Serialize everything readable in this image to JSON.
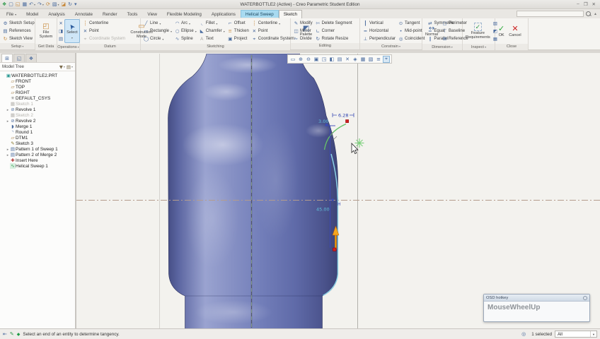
{
  "titlebar": {
    "title": "WATERBOTTLE2 (Active) - Creo Parametric Student Edition",
    "quick_access": [
      {
        "glyph": "❖",
        "icon": "creo-app-icon",
        "cls": "gr"
      },
      {
        "glyph": "▢",
        "icon": "new-file-icon"
      },
      {
        "glyph": "◱",
        "icon": "open-file-icon",
        "cls": "or"
      },
      {
        "glyph": "▦",
        "icon": "save-icon"
      },
      {
        "glyph": "↶",
        "icon": "undo-icon",
        "arrow": true
      },
      {
        "glyph": "↷",
        "icon": "redo-icon",
        "arrow": true
      },
      {
        "glyph": "⟳",
        "icon": "regenerate-icon",
        "cls": "or"
      },
      {
        "glyph": "▧",
        "icon": "window-gallery-icon",
        "arrow": true
      },
      {
        "glyph": "◪",
        "icon": "close-window-icon",
        "cls": "or"
      },
      {
        "glyph": "↻",
        "icon": "refresh-icon"
      },
      {
        "glyph": "▾",
        "icon": "customize-quick-access-icon"
      }
    ],
    "window_controls": [
      {
        "glyph": "–",
        "icon": "minimize-icon"
      },
      {
        "glyph": "❐",
        "icon": "restore-icon"
      },
      {
        "glyph": "✕",
        "icon": "close-icon"
      }
    ]
  },
  "tabs": [
    {
      "label": "File",
      "arrow": true
    },
    {
      "label": "Model"
    },
    {
      "label": "Analysis"
    },
    {
      "label": "Annotate"
    },
    {
      "label": "Render"
    },
    {
      "label": "Tools"
    },
    {
      "label": "View"
    },
    {
      "label": "Flexible Modeling"
    },
    {
      "label": "Applications"
    },
    {
      "label": "Helical Sweep",
      "cls": "context"
    },
    {
      "label": "Sketch",
      "cls": "active"
    }
  ],
  "ribbon": {
    "setup": {
      "label": "Setup",
      "items": [
        {
          "label": "Sketch Setup",
          "glyph": "⚙",
          "icon": "sketch-setup-icon"
        },
        {
          "label": "References",
          "glyph": "▤",
          "icon": "references-icon"
        },
        {
          "label": "Sketch View",
          "glyph": "↻",
          "icon": "sketch-view-icon",
          "cls": "or"
        }
      ]
    },
    "get_data": {
      "label": "Get Data",
      "big": {
        "label": "File System",
        "glyph": "◰",
        "icon": "file-system-icon"
      }
    },
    "operations": {
      "label": "Operations",
      "clipboard": [
        {
          "glyph": "✕",
          "icon": "cut-icon"
        },
        {
          "glyph": "◨",
          "icon": "copy-icon"
        },
        {
          "glyph": "▤",
          "icon": "paste-icon"
        }
      ],
      "select": {
        "label": "Select",
        "arrow": true
      }
    },
    "datum": {
      "label": "Datum",
      "items": [
        {
          "label": "Centerline",
          "glyph": "┆",
          "icon": "centerline-datum-icon",
          "cls": "or"
        },
        {
          "label": "Point",
          "glyph": "✕",
          "icon": "point-datum-icon"
        },
        {
          "label": "Coordinate System",
          "glyph": "⌖",
          "icon": "coordinate-system-datum-icon",
          "cls": "dis",
          "disabled": true
        }
      ],
      "big": {
        "label": "Construction Mode",
        "glyph": "▭",
        "icon": "construction-mode-icon"
      }
    },
    "sketching": {
      "label": "Sketching",
      "items": [
        {
          "label": "Line",
          "glyph": "╱",
          "icon": "line-tool-icon",
          "arrow": true
        },
        {
          "label": "Rectangle",
          "glyph": "▭",
          "icon": "rectangle-tool-icon",
          "arrow": true
        },
        {
          "label": "Circle",
          "glyph": "◯",
          "icon": "circle-tool-icon",
          "arrow": true
        },
        {
          "label": "Arc",
          "glyph": "◠",
          "icon": "arc-tool-icon",
          "arrow": true
        },
        {
          "label": "Ellipse",
          "glyph": "○",
          "icon": "ellipse-tool-icon",
          "arrow": true
        },
        {
          "label": "Spline",
          "glyph": "∿",
          "icon": "spline-tool-icon"
        },
        {
          "label": "Fillet",
          "glyph": "◟",
          "icon": "fillet-tool-icon",
          "arrow": true
        },
        {
          "label": "Chamfer",
          "glyph": "◣",
          "icon": "chamfer-tool-icon",
          "arrow": true
        },
        {
          "label": "Text",
          "glyph": "A",
          "icon": "text-tool-icon",
          "cls": "dis",
          "disabled": true
        },
        {
          "label": "Offset",
          "glyph": "⌐",
          "icon": "offset-tool-icon"
        },
        {
          "label": "Thicken",
          "glyph": "≡",
          "icon": "thicken-tool-icon",
          "cls": "or"
        },
        {
          "label": "Project",
          "glyph": "▣",
          "icon": "project-tool-icon"
        },
        {
          "label": "Centerline",
          "glyph": "┆",
          "icon": "centerline-tool-icon",
          "arrow": true,
          "cls": "or"
        },
        {
          "label": "Point",
          "glyph": "✕",
          "icon": "point-tool-icon"
        },
        {
          "label": "Coordinate System",
          "glyph": "⌖",
          "icon": "coordinate-system-tool-icon"
        }
      ],
      "palette": {
        "label": "Palette",
        "glyph": "◩",
        "icon": "palette-icon"
      }
    },
    "editing": {
      "label": "Editing",
      "items": [
        {
          "label": "Modify",
          "glyph": "✎",
          "icon": "modify-icon"
        },
        {
          "label": "Mirror",
          "glyph": "◫",
          "icon": "mirror-icon"
        },
        {
          "label": "Divide",
          "glyph": "✁",
          "icon": "divide-icon"
        },
        {
          "label": "Delete Segment",
          "glyph": "✄",
          "icon": "delete-segment-icon"
        },
        {
          "label": "Corner",
          "glyph": "∟",
          "icon": "corner-icon"
        },
        {
          "label": "Rotate Resize",
          "glyph": "↻",
          "icon": "rotate-resize-icon"
        }
      ]
    },
    "constrain": {
      "label": "Constrain",
      "items": [
        {
          "label": "Vertical",
          "glyph": "┃",
          "icon": "vertical-constraint-icon"
        },
        {
          "label": "Horizontal",
          "glyph": "━",
          "icon": "horizontal-constraint-icon"
        },
        {
          "label": "Perpendicular",
          "glyph": "⊥",
          "icon": "perpendicular-constraint-icon"
        },
        {
          "label": "Tangent",
          "glyph": "⊙",
          "icon": "tangent-constraint-icon"
        },
        {
          "label": "Mid-point",
          "glyph": "•",
          "icon": "midpoint-constraint-icon"
        },
        {
          "label": "Coincident",
          "glyph": "◎",
          "icon": "coincident-constraint-icon"
        },
        {
          "label": "Symmetric",
          "glyph": "⇄",
          "icon": "symmetric-constraint-icon"
        },
        {
          "label": "Equal",
          "glyph": "=",
          "icon": "equal-constraint-icon"
        },
        {
          "label": "Parallel",
          "glyph": "∥",
          "icon": "parallel-constraint-icon"
        }
      ]
    },
    "dimension": {
      "label": "Dimension",
      "big": {
        "label": "Normal",
        "glyph": "↔",
        "icon": "normal-dimension-icon"
      },
      "items": [
        {
          "label": "Perimeter",
          "glyph": "▢",
          "icon": "perimeter-dimension-icon"
        },
        {
          "label": "Baseline",
          "glyph": "⊤",
          "icon": "baseline-dimension-icon"
        },
        {
          "label": "Reference",
          "glyph": "⊞",
          "icon": "reference-dimension-icon"
        }
      ]
    },
    "inspect": {
      "label": "Inspect",
      "big": {
        "label": "Feature Requirements",
        "glyph": "✓",
        "icon": "feature-requirements-icon"
      },
      "items": [
        {
          "glyph": "▧",
          "icon": "shade-closed-loops-icon"
        },
        {
          "glyph": "◩",
          "icon": "highlight-open-ends-icon"
        },
        {
          "glyph": "▦",
          "icon": "overlapping-geometry-icon"
        }
      ]
    },
    "close": {
      "label": "Close",
      "ok": {
        "label": "OK"
      },
      "cancel": {
        "label": "Cancel"
      }
    }
  },
  "model_tree": {
    "title": "Model Tree",
    "panel_tabs": [
      {
        "glyph": "⊞",
        "icon": "model-tree-tab-icon",
        "cls": "sel"
      },
      {
        "glyph": "◱",
        "icon": "folder-browser-tab-icon"
      },
      {
        "glyph": "❖",
        "icon": "favorites-tab-icon"
      }
    ],
    "items": [
      {
        "label": "WATERBOTTLE2.PRT",
        "glyph": "▣",
        "icon": "part-icon",
        "cls": "part"
      },
      {
        "label": "FRONT",
        "glyph": "▱",
        "icon": "datum-plane-icon",
        "cls": "plane ind1"
      },
      {
        "label": "TOP",
        "glyph": "▱",
        "icon": "datum-plane-icon",
        "cls": "plane ind1"
      },
      {
        "label": "RIGHT",
        "glyph": "▱",
        "icon": "datum-plane-icon",
        "cls": "plane ind1"
      },
      {
        "label": "DEFAULT_CSYS",
        "glyph": "✳",
        "icon": "coordinate-system-icon",
        "cls": "csys ind1"
      },
      {
        "label": "Sketch 1",
        "glyph": "▦",
        "icon": "sketch-feature-icon",
        "cls": "disabled ind1"
      },
      {
        "label": "Revolve 1",
        "glyph": "⊘",
        "icon": "revolve-feature-icon",
        "cls": "ind1",
        "arrow": true
      },
      {
        "label": "Sketch 2",
        "glyph": "▦",
        "icon": "sketch-feature-icon",
        "cls": "disabled ind1"
      },
      {
        "label": "Revolve 2",
        "glyph": "⊘",
        "icon": "revolve-feature-icon",
        "cls": "ind1",
        "arrow": true
      },
      {
        "label": "Merge 1",
        "glyph": "◗",
        "icon": "merge-feature-icon",
        "cls": "ind1"
      },
      {
        "label": "Round 1",
        "glyph": "◝",
        "icon": "round-feature-icon",
        "cls": "ind1"
      },
      {
        "label": "DTM1",
        "glyph": "▱",
        "icon": "datum-plane-icon",
        "cls": "plane ind1"
      },
      {
        "label": "Sketch 3",
        "glyph": "✎",
        "icon": "sketch-feature-icon",
        "cls": "sketch ind1"
      },
      {
        "label": "Pattern 1 of Sweep 1",
        "glyph": "▤",
        "icon": "pattern-feature-icon",
        "cls": "ind1",
        "arrow": true
      },
      {
        "label": "Pattern 2 of Merge 2",
        "glyph": "▤",
        "icon": "pattern-feature-icon",
        "cls": "ind1",
        "arrow": true
      },
      {
        "label": "Insert Here",
        "glyph": "✚",
        "icon": "insert-here-icon",
        "cls": "insert ind1"
      },
      {
        "label": "Helical Sweep 1",
        "glyph": "∿",
        "icon": "helical-sweep-feature-icon",
        "cls": "helix ind1"
      }
    ]
  },
  "graphics_toolbar": {
    "items": [
      {
        "glyph": "▭",
        "icon": "refit-icon"
      },
      {
        "glyph": "⊕",
        "icon": "zoom-in-icon"
      },
      {
        "glyph": "⊖",
        "icon": "zoom-out-icon"
      },
      {
        "glyph": "▣",
        "icon": "repaint-icon"
      },
      {
        "glyph": "◳",
        "icon": "shading-style-icon"
      },
      {
        "glyph": "◧",
        "icon": "display-style-icon"
      },
      {
        "glyph": "▤",
        "icon": "saved-orientations-icon"
      },
      {
        "glyph": "✕",
        "icon": "view-manager-icon"
      },
      {
        "glyph": "◈",
        "icon": "annotation-display-icon"
      },
      {
        "glyph": "▦",
        "icon": "spin-center-icon"
      },
      {
        "glyph": "▧",
        "icon": "3d-dragger-icon"
      },
      {
        "glyph": "≡",
        "icon": "show-items-icon"
      },
      {
        "glyph": "⌖",
        "icon": "sketch-orientation-icon",
        "cls": "sel"
      }
    ]
  },
  "sketch": {
    "pitch_dim": "6.28",
    "arc_dim": "3.00",
    "height_dim": "45.00",
    "axis_label": "H"
  },
  "osd": {
    "title": "OSD hotkey",
    "message": "MouseWheelUp"
  },
  "statusbar": {
    "message": "Select an end of an entity to determine tangency.",
    "selected_count": "1 selected",
    "filter_value": "All"
  },
  "colors": {
    "context_tab_blue": "#a8daf0",
    "bottle_blue": "#6b77b4",
    "selected_edge_cyan": "#8fd8ea",
    "sketch_green": "#67c46a",
    "dimension_blue": "#3a4ab8",
    "weak_dimension_cyan": "#5fc0da",
    "direction_arrow_orange": "#f5a61e",
    "vertex_red": "#cf1f1f",
    "ok_green": "#2eaa3c",
    "cancel_red": "#cc2222"
  }
}
